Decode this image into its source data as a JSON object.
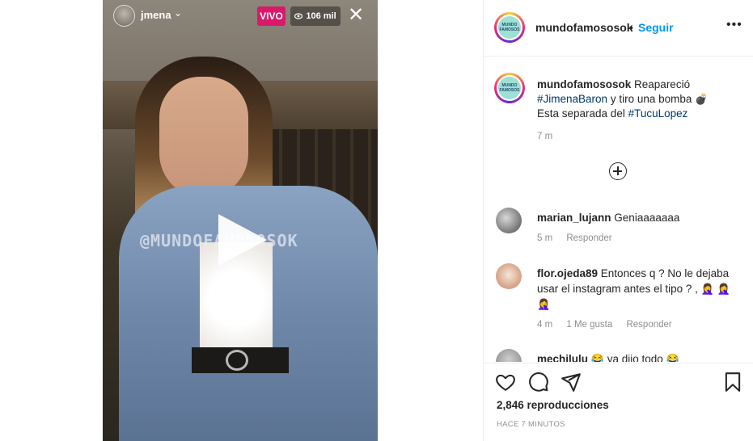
{
  "video": {
    "username": "jmena",
    "live_badge": "VIVO",
    "viewer_count": "106 mil",
    "watermark": "@MUNDOFAMOSOSOK"
  },
  "post": {
    "account": "mundofamososok",
    "separator": "•",
    "follow_label": "Seguir",
    "more_label": "•••",
    "avatar_logo_text": "MUNDO FAMOSOS",
    "caption": {
      "author": "mundofamososok",
      "part1": "Reapareció",
      "hashtag1": "#JimenaBaron",
      "part2": "y tiro una bomba",
      "emoji": "💣",
      "part3": "Esta separada del",
      "hashtag2": "#TucuLopez",
      "time": "7 m"
    },
    "comments": [
      {
        "user": "marian_lujann",
        "text": "Geniaaaaaaa",
        "time": "5 m",
        "likes": "",
        "reply": "Responder"
      },
      {
        "user": "flor.ojeda89",
        "text": "Entonces q ? No le dejaba usar el instagram antes el tipo ? ,",
        "emoji": "🤦‍♀️",
        "time": "4 m",
        "likes": "1 Me gusta",
        "reply": "Responder"
      },
      {
        "user": "mechilulu",
        "text": "ya dijo todo",
        "emoji": "😂"
      }
    ],
    "views": "2,846 reproducciones",
    "posted_ago": "HACE 7 MINUTOS"
  },
  "colors": {
    "accent": "#0095f6",
    "live": "#d9196b",
    "hashtag": "#00376b",
    "muted": "#8e8e8e"
  },
  "icons": [
    "heart-icon",
    "comment-icon",
    "share-icon",
    "bookmark-icon",
    "play-icon",
    "close-icon",
    "eye-icon",
    "add-comment-icon"
  ]
}
